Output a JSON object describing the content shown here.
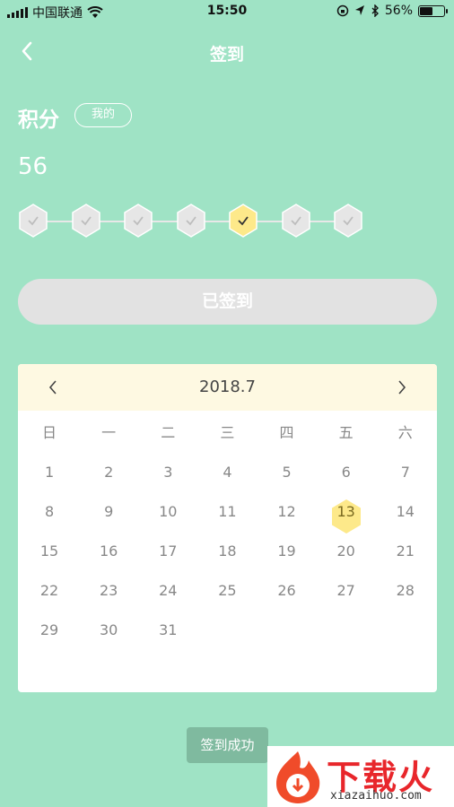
{
  "status_bar": {
    "carrier": "中国联通",
    "time": "15:50",
    "battery_percent": "56%",
    "battery_level": 0.56
  },
  "nav": {
    "title": "签到",
    "back_icon": "chevron-left-icon"
  },
  "points": {
    "label": "积分",
    "mine_button": "我的",
    "value": "56"
  },
  "week": {
    "days": [
      {
        "checked": false
      },
      {
        "checked": false
      },
      {
        "checked": false
      },
      {
        "checked": false
      },
      {
        "checked": true
      },
      {
        "checked": false
      },
      {
        "checked": false
      }
    ],
    "inactive_color": "#e6e6e6",
    "active_color": "#fde98a"
  },
  "sign_button": {
    "label": "已签到"
  },
  "calendar": {
    "month": "2018.7",
    "weekdays": [
      "日",
      "一",
      "二",
      "三",
      "四",
      "五",
      "六"
    ],
    "weeks": [
      [
        "1",
        "2",
        "3",
        "4",
        "5",
        "6",
        "7"
      ],
      [
        "8",
        "9",
        "10",
        "11",
        "12",
        "13",
        "14"
      ],
      [
        "15",
        "16",
        "17",
        "18",
        "19",
        "20",
        "21"
      ],
      [
        "22",
        "23",
        "24",
        "25",
        "26",
        "27",
        "28"
      ],
      [
        "29",
        "30",
        "31",
        "",
        "",
        "",
        ""
      ]
    ],
    "highlighted_day": "13",
    "header_color": "#fef9e2"
  },
  "toast": {
    "text": "签到成功"
  },
  "watermark": {
    "name": "下载火",
    "url": "xiazaihuo.com"
  },
  "colors": {
    "background": "#9fe3c5",
    "highlight": "#fde98a"
  }
}
